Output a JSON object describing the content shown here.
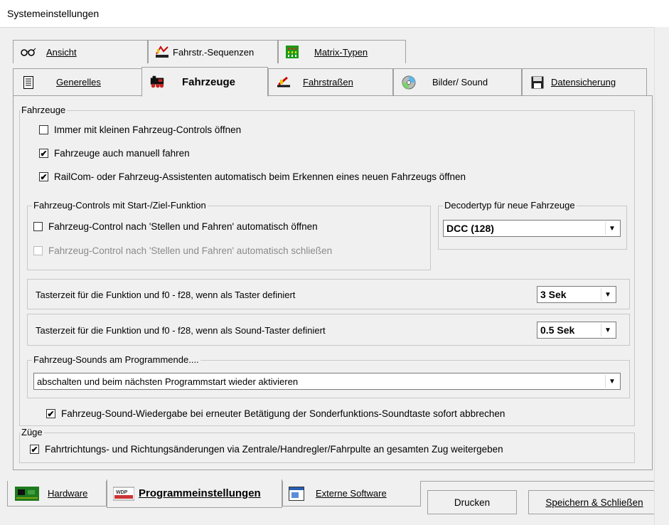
{
  "window": {
    "title": "Systemeinstellungen"
  },
  "tabs_row1": [
    {
      "label": "Ansicht",
      "icon": "glasses-icon"
    },
    {
      "label": "Fahrstr.-Sequenzen",
      "icon": "sequence-icon"
    },
    {
      "label": "Matrix-Typen",
      "icon": "matrix-icon"
    }
  ],
  "tabs_row2": [
    {
      "label": "Generelles",
      "icon": "document-icon"
    },
    {
      "label": "Fahrzeuge",
      "icon": "locomotive-icon",
      "active": true
    },
    {
      "label": "Fahrstraßen",
      "icon": "route-icon"
    },
    {
      "label": "Bilder/ Sound",
      "icon": "cd-icon"
    },
    {
      "label": "Datensicherung",
      "icon": "floppy-icon"
    }
  ],
  "fahrzeuge": {
    "legend": "Fahrzeuge",
    "cb_small_controls": {
      "label": "Immer mit kleinen Fahrzeug-Controls öffnen",
      "checked": false
    },
    "cb_manual": {
      "label": "Fahrzeuge auch manuell fahren",
      "checked": true
    },
    "cb_railcom": {
      "label": "RailCom- oder Fahrzeug-Assistenten automatisch beim Erkennen eines neuen Fahrzeugs öffnen",
      "checked": true
    },
    "controls_group": {
      "legend": "Fahrzeug-Controls mit Start-/Ziel-Funktion",
      "cb_open": {
        "label": "Fahrzeug-Control nach 'Stellen und Fahren' automatisch öffnen",
        "checked": false
      },
      "cb_close": {
        "label": "Fahrzeug-Control nach 'Stellen und Fahren' automatisch schließen",
        "checked": false
      }
    },
    "decoder_group": {
      "legend": "Decodertyp für neue Fahrzeuge",
      "value": "DCC (128)"
    },
    "taster": {
      "label": "Tasterzeit für die Funktion und f0 - f28, wenn als Taster definiert",
      "value": "3 Sek"
    },
    "sound_taster": {
      "label": "Tasterzeit für die Funktion und f0 - f28, wenn als Sound-Taster definiert",
      "value": "0.5 Sek"
    },
    "sounds_group": {
      "legend": "Fahrzeug-Sounds am Programmende....",
      "value": "abschalten und beim nächsten Programmstart wieder aktivieren"
    },
    "cb_sound_abort": {
      "label": "Fahrzeug-Sound-Wiedergabe bei erneuter Betätigung der Sonderfunktions-Soundtaste sofort abbrechen",
      "checked": true
    }
  },
  "zuege": {
    "legend": "Züge",
    "cb_direction": {
      "label": "Fahrtrichtungs- und Richtungsänderungen via Zentrale/Handregler/Fahrpulte an gesamten Zug weitergeben",
      "checked": true
    }
  },
  "bottom_tabs": [
    {
      "label": "Hardware",
      "icon": "circuit-board-icon"
    },
    {
      "label": "Programmeinstellungen",
      "icon": "wdp-icon",
      "active": true
    },
    {
      "label": "Externe Software",
      "icon": "window-icon"
    }
  ],
  "buttons": {
    "print": "Drucken",
    "save_close": "Speichern & Schließen"
  },
  "check_mark": "✔",
  "dropdown_arrow": "▼"
}
